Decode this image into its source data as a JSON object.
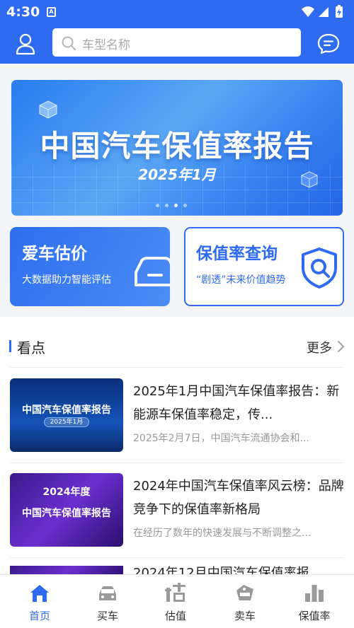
{
  "status_bar": {
    "time": "4:30",
    "notification_badge": "A"
  },
  "header": {
    "search_placeholder": "车型名称",
    "accent_color": "#2f6bf0"
  },
  "banner": {
    "title": "中国汽车保值率报告",
    "subtitle": "2025年1月",
    "page_count": 4,
    "active_page": 3
  },
  "feature_cards": [
    {
      "title": "爱车估价",
      "subtitle": "大数据助力智能评估"
    },
    {
      "title": "保值率查询",
      "subtitle": "“剧透”未来价值趋势"
    }
  ],
  "section": {
    "title": "看点",
    "more_label": "更多"
  },
  "articles": [
    {
      "title": "2025年1月中国汽车保值率报告：新能源车保值率稳定，传...",
      "desc": "2025年2月7日，中国汽车流通协会和...",
      "thumb_title": "中国汽车保值率报告",
      "thumb_sub": "2025年1月"
    },
    {
      "title": "2024年中国汽车保值率风云榜：品牌竞争下的保值率新格局",
      "desc": "在经历了数年的快速发展与不断调整之...",
      "thumb_year": "2024年度",
      "thumb_title": "中国汽车保值率报告"
    },
    {
      "title": "2024年12月中国汽车保值率报"
    }
  ],
  "tabbar": [
    {
      "label": "首页",
      "icon": "home-icon",
      "active": true
    },
    {
      "label": "买车",
      "icon": "car-icon",
      "active": false
    },
    {
      "label": "估值",
      "icon": "valuation-icon",
      "active": false
    },
    {
      "label": "卖车",
      "icon": "sale-tag-icon",
      "active": false
    },
    {
      "label": "保值率",
      "icon": "bar-chart-icon",
      "active": false
    }
  ]
}
